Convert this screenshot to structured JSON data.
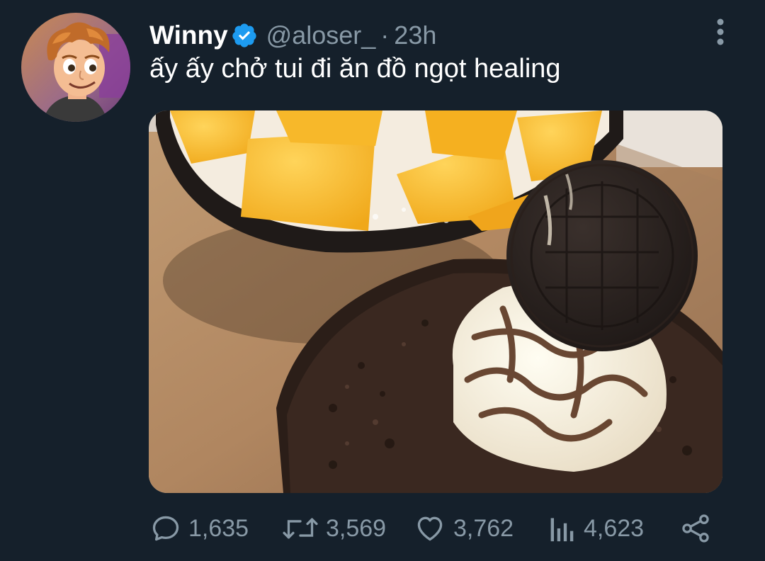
{
  "tweet": {
    "author_name": "Winny",
    "handle": "@aloser_",
    "separator": "·",
    "timestamp": "23h",
    "text": "ấy ấy chở tui đi ăn đồ ngọt healing",
    "verified": true,
    "avatar_icon": "cartoon-character-avatar",
    "media": {
      "description_icon": "dessert-photo",
      "alt": "mango bingsu and oreo bingsu"
    }
  },
  "actions": {
    "reply_count": "1,635",
    "retweet_count": "3,569",
    "like_count": "3,762",
    "views_count": "4,623"
  },
  "colors": {
    "background": "#15202b",
    "secondary_text": "#8899a6",
    "verified_blue": "#1d9bf0"
  }
}
